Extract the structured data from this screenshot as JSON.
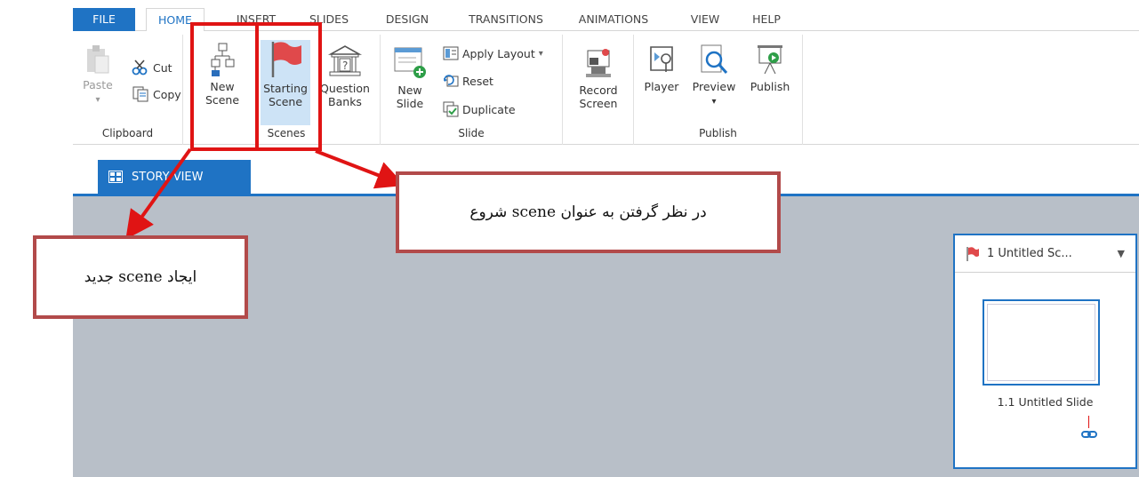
{
  "tabs": [
    "FILE",
    "HOME",
    "INSERT",
    "SLIDES",
    "DESIGN",
    "TRANSITIONS",
    "ANIMATIONS",
    "VIEW",
    "HELP"
  ],
  "clipboard": {
    "paste": "Paste",
    "cut": "Cut",
    "copy": "Copy",
    "group": "Clipboard"
  },
  "scenes": {
    "new_scene": "New\nScene",
    "starting_scene": "Starting\nScene",
    "question_banks": "Question\nBanks",
    "group": "Scenes"
  },
  "slide": {
    "new_slide": "New\nSlide",
    "apply_layout": "Apply Layout",
    "reset": "Reset",
    "duplicate": "Duplicate",
    "group": "Slide"
  },
  "record": {
    "label": "Record\nScreen"
  },
  "publish": {
    "player": "Player",
    "preview": "Preview",
    "publish": "Publish",
    "group": "Publish"
  },
  "story_view": {
    "label": "STORY VIEW"
  },
  "scene_card": {
    "title": "1 Untitled Sc...",
    "slide_title": "1.1 Untitled Slide"
  },
  "annotations": {
    "starting": "در نظر گرفتن به عنوان scene شروع",
    "new": "ایجاد scene جدید"
  },
  "colors": {
    "accent": "#1f73c4",
    "annotation_red": "#e01414",
    "callout_border": "#b24a4a",
    "canvas": "#b8bfc8"
  }
}
